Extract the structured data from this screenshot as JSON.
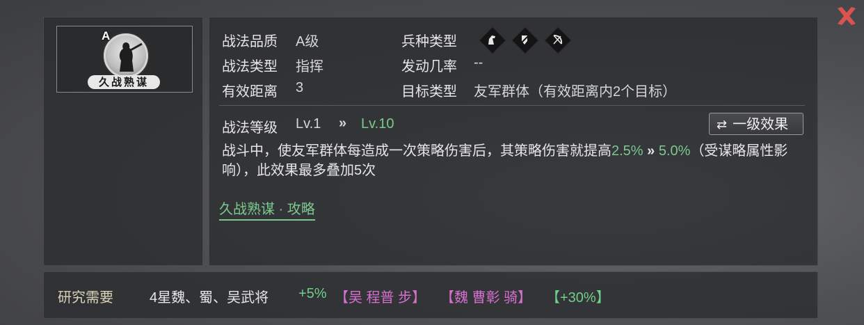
{
  "card": {
    "grade": "A",
    "name": "久战熟谋"
  },
  "info": {
    "quality_label": "战法品质",
    "quality_value": "A级",
    "type_label": "战法类型",
    "type_value": "指挥",
    "range_label": "有效距离",
    "range_value": "3",
    "unit_label": "兵种类型",
    "unit_icons": [
      "cavalry-icon",
      "shield-icon",
      "bow-icon"
    ],
    "chance_label": "发动几率",
    "chance_value": "--",
    "target_label": "目标类型",
    "target_value": "友军群体（有效距离内2个目标）"
  },
  "level": {
    "label": "战法等级",
    "from": "Lv.1",
    "arrow": "»",
    "to": "Lv.10",
    "button_label": "一级效果"
  },
  "description": {
    "part1": "战斗中，使友军群体每造成一次策略伤害后，其策略伤害就提高",
    "value_from": "2.5%",
    "arrow": "»",
    "value_to": "5.0%",
    "part2": "（受谋略属性影响），此效果最多叠加5次"
  },
  "guide_link": "久战熟谋 · 攻略",
  "research": {
    "label": "研究需要",
    "requirement": "4星魏、蜀、吴武将",
    "bonus": "+5%",
    "group1": "【吴 程普 步】",
    "group2": "【魏 曹彰 骑】",
    "group3": "【+30%】"
  },
  "colors": {
    "accent_green": "#7bc98f",
    "accent_pink": "#d76fd0",
    "close_red": "#d9534f"
  }
}
